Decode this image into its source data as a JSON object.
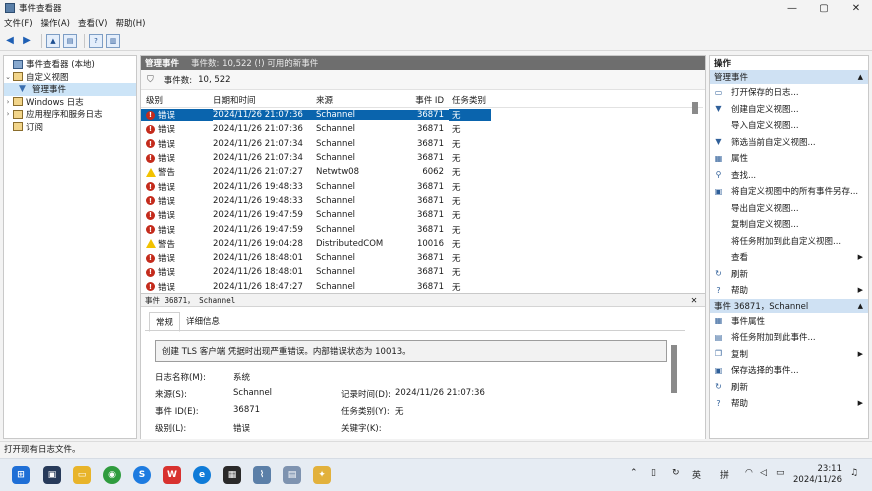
{
  "window": {
    "title": "事件查看器",
    "min": "—",
    "max": "▢",
    "close": "✕"
  },
  "menu": [
    "文件(F)",
    "操作(A)",
    "查看(V)",
    "帮助(H)"
  ],
  "tree": {
    "root": "事件查看器 (本地)",
    "custom_views": "自定义视图",
    "admin_events": "管理事件",
    "windows_logs": "Windows 日志",
    "app_logs": "应用程序和服务日志",
    "subscriptions": "订阅"
  },
  "panel": {
    "title": "管理事件",
    "subtitle": "事件数: 10,522 (!) 可用的新事件",
    "filter_label": "事件数:",
    "filter_count": "10, 522"
  },
  "columns": {
    "level": "级别",
    "date": "日期和时间",
    "source": "来源",
    "event_id": "事件 ID",
    "task": "任务类别"
  },
  "events": [
    {
      "level": "错误",
      "type": "error",
      "date": "2024/11/26 21:07:36",
      "source": "Schannel",
      "id": "36871",
      "task": "无"
    },
    {
      "level": "错误",
      "type": "error",
      "date": "2024/11/26 21:07:36",
      "source": "Schannel",
      "id": "36871",
      "task": "无"
    },
    {
      "level": "错误",
      "type": "error",
      "date": "2024/11/26 21:07:34",
      "source": "Schannel",
      "id": "36871",
      "task": "无"
    },
    {
      "level": "错误",
      "type": "error",
      "date": "2024/11/26 21:07:34",
      "source": "Schannel",
      "id": "36871",
      "task": "无"
    },
    {
      "level": "警告",
      "type": "warning",
      "date": "2024/11/26 21:07:27",
      "source": "Netwtw08",
      "id": "6062",
      "task": "无"
    },
    {
      "level": "错误",
      "type": "error",
      "date": "2024/11/26 19:48:33",
      "source": "Schannel",
      "id": "36871",
      "task": "无"
    },
    {
      "level": "错误",
      "type": "error",
      "date": "2024/11/26 19:48:33",
      "source": "Schannel",
      "id": "36871",
      "task": "无"
    },
    {
      "level": "错误",
      "type": "error",
      "date": "2024/11/26 19:47:59",
      "source": "Schannel",
      "id": "36871",
      "task": "无"
    },
    {
      "level": "错误",
      "type": "error",
      "date": "2024/11/26 19:47:59",
      "source": "Schannel",
      "id": "36871",
      "task": "无"
    },
    {
      "level": "警告",
      "type": "warning",
      "date": "2024/11/26 19:04:28",
      "source": "DistributedCOM",
      "id": "10016",
      "task": "无"
    },
    {
      "level": "错误",
      "type": "error",
      "date": "2024/11/26 18:48:01",
      "source": "Schannel",
      "id": "36871",
      "task": "无"
    },
    {
      "level": "错误",
      "type": "error",
      "date": "2024/11/26 18:48:01",
      "source": "Schannel",
      "id": "36871",
      "task": "无"
    },
    {
      "level": "错误",
      "type": "error",
      "date": "2024/11/26 18:47:27",
      "source": "Schannel",
      "id": "36871",
      "task": "无"
    }
  ],
  "detail": {
    "header": "事件 36871， Schannel",
    "tab_general": "常规",
    "tab_details": "详细信息",
    "message": "创建 TLS 客户端 凭据时出现严重错误。内部错误状态为 10013。",
    "log_name_label": "日志名称(M):",
    "log_name": "系统",
    "source_label": "来源(S):",
    "source": "Schannel",
    "logged_label": "记录时间(D):",
    "logged": "2024/11/26 21:07:36",
    "event_id_label": "事件 ID(E):",
    "event_id": "36871",
    "task_label": "任务类别(Y):",
    "task": "无",
    "level_label": "级别(L):",
    "level": "错误",
    "keywords_label": "关键字(K):"
  },
  "actions": {
    "header": "操作",
    "section1": "管理事件",
    "items1": [
      {
        "label": "打开保存的日志...",
        "icon": "folder-open-icon",
        "sub": false
      },
      {
        "label": "创建自定义视图...",
        "icon": "filter-create-icon",
        "sub": false
      },
      {
        "label": "导入自定义视图...",
        "icon": "none",
        "sub": false
      },
      {
        "label": "筛选当前自定义视图...",
        "icon": "filter-icon",
        "sub": false
      },
      {
        "label": "属性",
        "icon": "properties-icon",
        "sub": false
      },
      {
        "label": "查找...",
        "icon": "find-icon",
        "sub": false
      },
      {
        "label": "将自定义视图中的所有事件另存...",
        "icon": "save-icon",
        "sub": false
      },
      {
        "label": "导出自定义视图...",
        "icon": "none",
        "sub": false
      },
      {
        "label": "复制自定义视图...",
        "icon": "none",
        "sub": false
      },
      {
        "label": "将任务附加到此自定义视图...",
        "icon": "none",
        "sub": false
      },
      {
        "label": "查看",
        "icon": "none",
        "sub": true
      },
      {
        "label": "刷新",
        "icon": "refresh-icon",
        "sub": false
      },
      {
        "label": "帮助",
        "icon": "help-icon",
        "sub": true
      }
    ],
    "section2": "事件 36871，Schannel",
    "items2": [
      {
        "label": "事件属性",
        "icon": "properties-icon",
        "sub": false
      },
      {
        "label": "将任务附加到此事件...",
        "icon": "task-icon",
        "sub": false
      },
      {
        "label": "复制",
        "icon": "copy-icon",
        "sub": true
      },
      {
        "label": "保存选择的事件...",
        "icon": "save-icon",
        "sub": false
      },
      {
        "label": "刷新",
        "icon": "refresh-icon",
        "sub": false
      },
      {
        "label": "帮助",
        "icon": "help-icon",
        "sub": true
      }
    ]
  },
  "status": "打开现有日志文件。",
  "tray": {
    "ime_en": "英",
    "ime_mode": "拼",
    "time": "23:11",
    "date": "2024/11/26"
  }
}
